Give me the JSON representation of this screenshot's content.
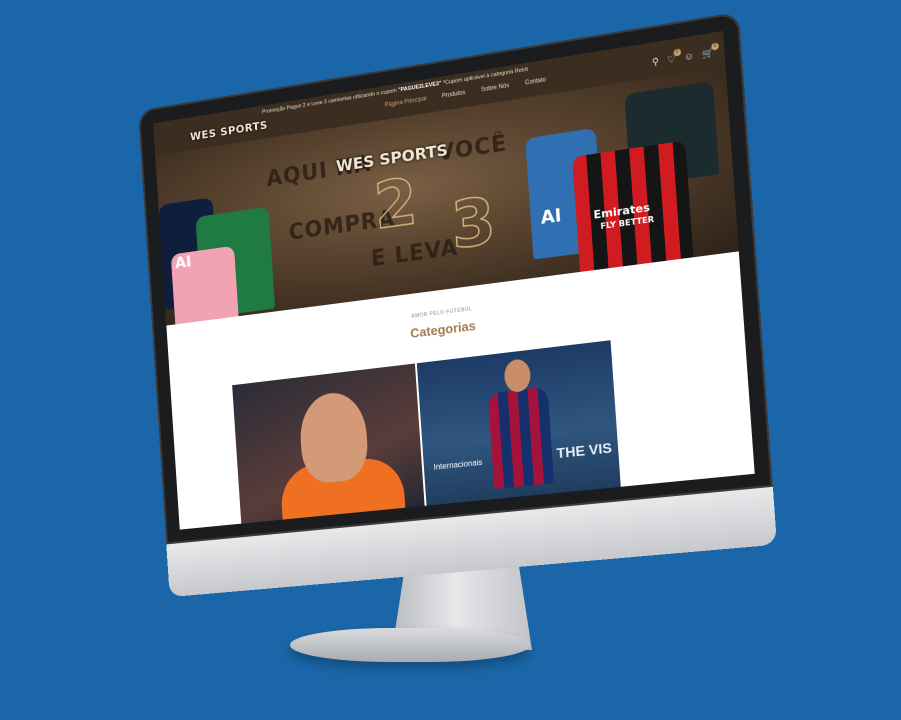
{
  "header": {
    "logo_text": "WES SPORTS",
    "promo_prefix": "Promoção Pague 2 e Leve 3 camisetas utilizando o cupom",
    "promo_code": "\"PAGUE2LEVE3\"",
    "promo_suffix": "*Cupom aplicável à categoria Retrô",
    "nav": {
      "home": "Página Principal",
      "products": "Produtos",
      "about": "Sobre Nós",
      "contact": "Contato"
    },
    "wishlist_count": "0",
    "cart_count": "0"
  },
  "hero": {
    "line1": "AQUI NA",
    "line1b": "VOCÊ",
    "line2": "COMPRA",
    "line3": "E LEVA",
    "num_a": "2",
    "num_b": "3",
    "logo": "WES SPORTS",
    "jersey_text_1": "AI",
    "jersey_text_2": "AI",
    "jersey_text_3": "Emirates",
    "jersey_text_4": "FLY BETTER"
  },
  "categories": {
    "kicker": "AMOR PELO FUTEBOL",
    "title": "Categorias",
    "cards": [
      {
        "label": ""
      },
      {
        "label": "Internacionais",
        "sponsor": "THE VIS"
      }
    ]
  },
  "colors": {
    "background": "#1a66a8",
    "header_bg": "#3b2d20",
    "accent": "#a57a4b"
  }
}
